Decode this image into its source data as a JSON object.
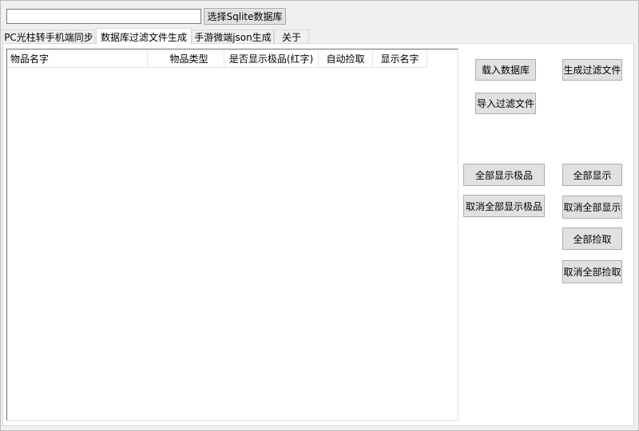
{
  "toolbar": {
    "path_value": "",
    "select_db_label": "选择Sqlite数据库"
  },
  "tabs": [
    {
      "label": "PC光柱转手机端同步"
    },
    {
      "label": "数据库过滤文件生成"
    },
    {
      "label": "手游微端json生成"
    },
    {
      "label": "关于"
    }
  ],
  "table": {
    "columns": [
      "物品名字",
      "物品类型",
      "是否显示极品(红字)",
      "自动捡取",
      "显示名字"
    ]
  },
  "buttons": {
    "load_db": "载入数据库",
    "generate_filter": "生成过滤文件",
    "import_filter": "导入过滤文件",
    "show_all_rare": "全部显示极品",
    "show_all": "全部显示",
    "cancel_all_rare": "取消全部显示极品",
    "cancel_all_show": "取消全部显示",
    "pick_all": "全部捡取",
    "cancel_all_pick": "取消全部捡取"
  }
}
